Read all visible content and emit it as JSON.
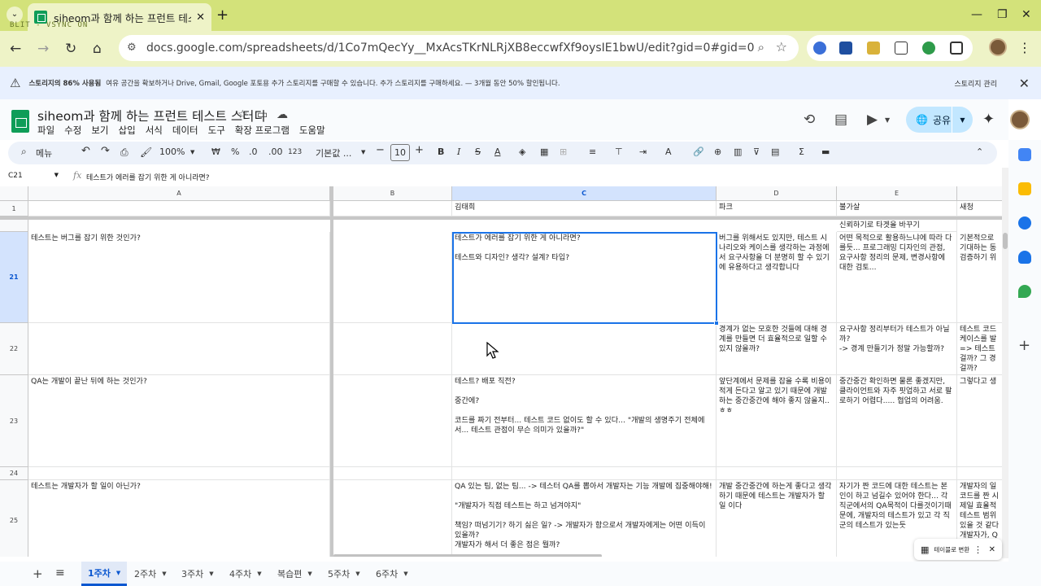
{
  "browser": {
    "tab_title": "siheom과 함께 하는 프런트 테스트 스터디",
    "overlay_text": "BLIT - VSYNC ON",
    "url": "docs.google.com/spreadsheets/d/1Co7mQecYy__MxAcsTKrNLRjXB8eccwfXf9oysIE1bwU/edit?gid=0#gid=0"
  },
  "banner": {
    "bold": "스토리지의 86% 사용됨",
    "text": "여유 공간을 확보하거나 Drive, Gmail, Google 포토용 추가 스토리지를 구매할 수 있습니다. 추가 스토리지를 구매하세요. — 3개월 동안 50% 할인됩니다.",
    "manage": "스토리지 관리"
  },
  "doc": {
    "title": "siheom과 함께 하는 프런트 테스트 스터디",
    "menus": [
      "파일",
      "수정",
      "보기",
      "삽입",
      "서식",
      "데이터",
      "도구",
      "확장 프로그램",
      "도움말"
    ],
    "share": "공유"
  },
  "toolbar": {
    "search": "메뉴",
    "zoom": "100%",
    "currency": "₩",
    "percent": "%",
    "dec_dec": ".0",
    "dec_inc": ".00",
    "number_format": "123",
    "font": "기본값 ...",
    "font_size": "10"
  },
  "formula_bar": {
    "cell_ref": "C21",
    "formula": "테스트가 에러를 잡기 위한 게 아니라면?"
  },
  "columns": [
    "A",
    "B",
    "C",
    "D",
    "E"
  ],
  "row1": {
    "num": "1",
    "C": "김태희",
    "D": "파크",
    "E": "불가살",
    "F": "새청"
  },
  "row_top_partial": "신뢰하기로 타겟을 바꾸기",
  "rows": [
    {
      "num": "21",
      "A": "테스트는 버그를 잡기 위한 것인가?",
      "C": "테스트가 에러를 잡기 위한 게 아니라면?\n\n테스트와 디자인? 생각? 설계? 타입?",
      "D": "버그를 위해서도 있지만, 테스트 시나리오와 케이스를 생각하는 과정에서 요구사항을 더 분명히 할 수 있기에 유용하다고 생각합니다",
      "E": "어떤 목적으로 활용하느냐에 따라 다를듯... 프로그래밍 디자인의 관점, 요구사항 정리의 문제, 변경사항에 대한 검토...",
      "F": "기본적으로\n기대하는 동\n검증하기 위"
    },
    {
      "num": "22",
      "A": "",
      "C": "",
      "D": "경계가 없는 모호한 것들에 대해 경계를 만들면 더 효율적으로 일할 수 있지 않을까?",
      "E": "요구사항 정리부터가 테스트가 아닐까?\n-> 경계 만들기가 정말 가능할까?",
      "F": "테스트 코드\n케이스를 발\n=> 테스트\n걸까? 그 경\n걸까?"
    },
    {
      "num": "23",
      "A": "QA는 개발이 끝난 뒤에 하는 것인가?",
      "C": "테스트? 배포 직전?\n\n중간에?\n\n코드를 짜기 전부터... 테스트 코드 없이도 할 수 있다... \"개발의 생명주기 전체에서... 테스트 관점이 무슨 의미가 있을까?\"",
      "D": "앞단계에서 문제를 잡을 수록 비용이 적게 든다고 알고 있기 때문에 개발하는 중간중간에 해야 좋지 않을지..ㅎㅎ",
      "E": "중간중간 확인하면 물론 좋겠지만, 클라이언트와 자주 핏업하고 서로 팔로하기 어렵다..... 협업의 어려움.",
      "F": "그렇다고 생"
    },
    {
      "num": "24",
      "A": "",
      "C": "",
      "D": "",
      "E": "",
      "F": ""
    },
    {
      "num": "25",
      "A": "테스트는 개발자가 할 일이 아닌가?",
      "C": "QA 있는 팀, 없는 팀... -> 테스터 QA를 뽑아서 개발자는 기능 개발에 집중해야해!\n\n\"개발자가 직접 테스트는 하고 넘겨야지\"\n\n책임? 떠넘기기? 하기 싫은 일? -> 개발자가 함으로서 개발자에게는 어떤 이득이 있을까?\n개발자가 해서 더 좋은 점은 뭘까?",
      "D": "개발 중간중간에 하는게 좋다고 생각하기 때문에 테스트는 개발자가 할 일 이다",
      "E": "자기가 짠 코드에 대한 테스트는 본인이 하고 넘길수 있어야 한다... 각 직군에서의 QA목적이 다를것이기때문에, 개발자의 테스트가 있고 각 직군의 테스트가 있는듯",
      "F": "개발자의 일\n코드를 짠 시\n제일 효율적\n테스트 범위\n있을 것 같다\n개발자가, Q"
    }
  ],
  "sheets": [
    "1주차",
    "2주차",
    "3주차",
    "4주차",
    "복습편",
    "5주차",
    "6주차"
  ],
  "active_sheet": "1주차",
  "table_convert": "테이블로 변환"
}
